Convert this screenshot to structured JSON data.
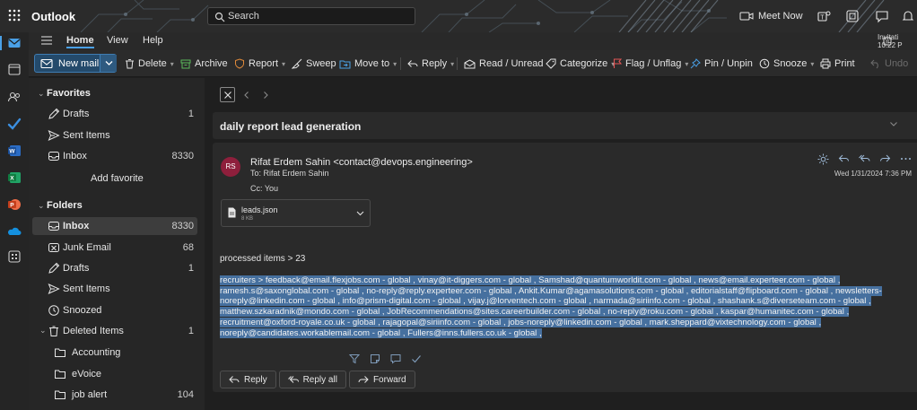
{
  "app": {
    "name": "Outlook",
    "search_placeholder": "Search",
    "meet_now": "Meet Now"
  },
  "ribbon": {
    "tabs": [
      {
        "label": "Home",
        "active": true
      },
      {
        "label": "View",
        "active": false
      },
      {
        "label": "Help",
        "active": false
      }
    ],
    "invitation_title": "Invitati",
    "invitation_time": "10:22 P"
  },
  "toolbar": {
    "new_mail": "New mail",
    "delete": "Delete",
    "archive": "Archive",
    "report": "Report",
    "sweep": "Sweep",
    "move_to": "Move to",
    "reply": "Reply",
    "read_unread": "Read / Unread",
    "categorize": "Categorize",
    "flag_unflag": "Flag / Unflag",
    "pin_unpin": "Pin / Unpin",
    "snooze": "Snooze",
    "print": "Print",
    "undo": "Undo"
  },
  "folders": {
    "favorites_header": "Favorites",
    "favorites": [
      {
        "label": "Drafts",
        "count": "1"
      },
      {
        "label": "Sent Items",
        "count": ""
      },
      {
        "label": "Inbox",
        "count": "8330"
      }
    ],
    "add_favorite": "Add favorite",
    "folders_header": "Folders",
    "items": [
      {
        "label": "Inbox",
        "count": "8330"
      },
      {
        "label": "Junk Email",
        "count": "68"
      },
      {
        "label": "Drafts",
        "count": "1"
      },
      {
        "label": "Sent Items",
        "count": ""
      },
      {
        "label": "Snoozed",
        "count": ""
      },
      {
        "label": "Deleted Items",
        "count": "1"
      },
      {
        "label": "Accounting",
        "count": ""
      },
      {
        "label": "eVoice",
        "count": ""
      },
      {
        "label": "job alert",
        "count": "104"
      }
    ]
  },
  "message": {
    "subject": "daily report lead generation",
    "avatar_initials": "RS",
    "from": "Rifat Erdem Sahin <contact@devops.engineering>",
    "to": "To:  Rifat Erdem Sahin",
    "cc": "Cc:  You",
    "date": "Wed 1/31/2024 7:36 PM",
    "attachment_name": "leads.json",
    "attachment_size": "8 KB",
    "processed": "processed items > 23",
    "body_lines": [
      "recruiters > feedback@email.flexjobs.com - global , vinay@it-diggers.com - global , Samshad@quantumworldit.com - global , news@email.experteer.com - global ,",
      "ramesh.s@saxonglobal.com - global , no-reply@reply.experteer.com - global , Ankit.Kumar@agamasolutions.com - global , editorialstaff@flipboard.com - global , newsletters-",
      "noreply@linkedin.com - global , info@prism-digital.com - global , vijay.j@lorventech.com - global , narmada@siriinfo.com - global , shashank.s@diverseteam.com - global ,",
      "matthew.szkaradnik@mondo.com - global , JobRecommendations@sites.careerbuilder.com - global , no-reply@roku.com - global , kaspar@humanitec.com - global ,",
      "recruitment@oxford-royale.co.uk - global , rajagopal@siriinfo.com - global , jobs-noreply@linkedin.com - global , mark.sheppard@vixtechnology.com - global ,",
      "noreply@candidates.workablemail.com - global , Fullers@inns.fullers.co.uk - global ,"
    ],
    "reply": "Reply",
    "reply_all": "Reply all",
    "forward": "Forward"
  },
  "colors": {
    "accent": "#4aa0e6",
    "avatar": "#8e1f3c",
    "selection": "#46709f",
    "new_mail_bg": "#244a6b",
    "flag": "#e05555",
    "report": "#e08a3a",
    "archive": "#5bb85b"
  }
}
